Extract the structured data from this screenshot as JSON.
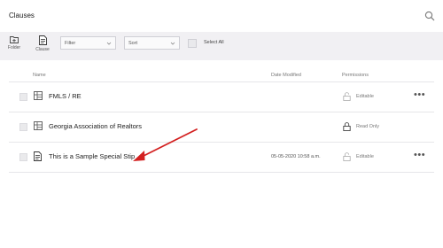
{
  "header": {
    "title": "Clauses",
    "search_icon": "search-icon"
  },
  "toolbar": {
    "folder_label": "Folder",
    "clause_label": "Clause",
    "filter_label": "Filter",
    "sort_label": "Sort",
    "select_all_label": "Select All"
  },
  "table": {
    "columns": {
      "name": "Name",
      "date": "Date Modified",
      "permissions": "Permissions"
    },
    "rows": [
      {
        "name": "FMLS / RE",
        "date": "",
        "permission": "Editable",
        "type_icon": "folder-grid-icon",
        "perm_icon": "unlock-icon",
        "more": "•••"
      },
      {
        "name": "Georgia Association of Realtors",
        "date": "",
        "permission": "Read Only",
        "type_icon": "folder-grid-icon",
        "perm_icon": "lock-icon",
        "more": ""
      },
      {
        "name": "This is a Sample Special Stip",
        "date": "05-05-2020 10:58 a.m.",
        "permission": "Editable",
        "type_icon": "document-icon",
        "perm_icon": "unlock-icon",
        "more": "•••"
      }
    ]
  },
  "colors": {
    "toolbar_bg": "#f1f0f3",
    "arrow": "#d32020",
    "divider": "#e6e6e9"
  }
}
